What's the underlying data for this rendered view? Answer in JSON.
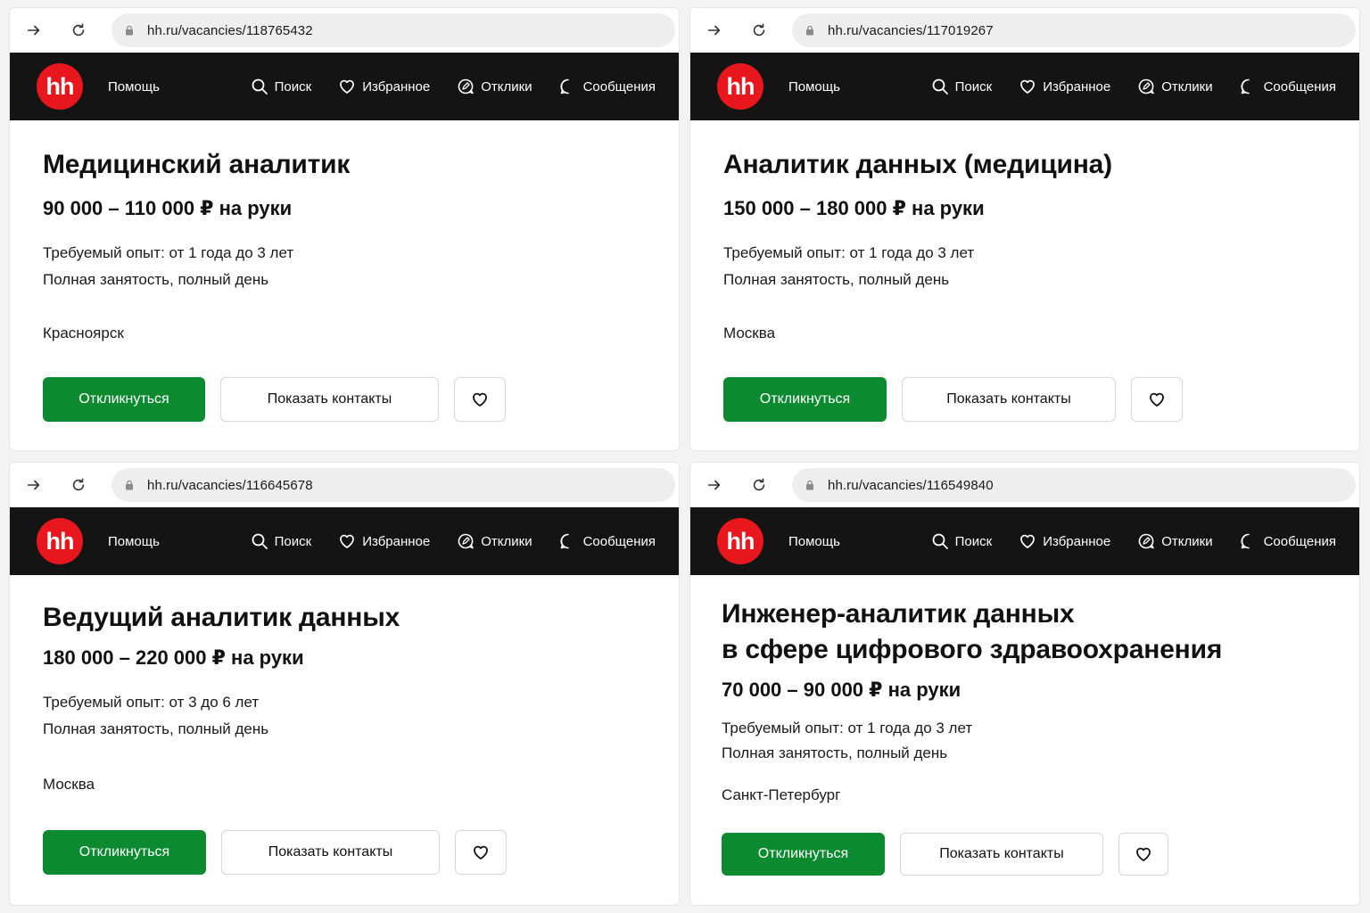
{
  "colors": {
    "brand_red": "#e8171d",
    "header_bg": "#141414",
    "apply_green": "#0b8a2f"
  },
  "icons": {
    "forward": "arrow-right-icon",
    "reload": "reload-icon",
    "lock": "lock-icon",
    "search": "search-icon",
    "favorites": "heart-icon",
    "responses": "chat-pen-icon",
    "messages": "chat-bubble-icon"
  },
  "common": {
    "logo_text": "hh",
    "help": "Помощь",
    "nav": {
      "search": "Поиск",
      "favorites": "Избранное",
      "responses": "Отклики",
      "messages": "Сообщения"
    },
    "apply_label": "Откликнуться",
    "contacts_label": "Показать контакты"
  },
  "vacancies": [
    {
      "url": "hh.ru/vacancies/118765432",
      "title_line1": "Медицинский аналитик",
      "title_line2": "",
      "salary": "90 000 – 110 000 ₽ на руки",
      "experience": "Требуемый опыт: от 1 года до 3 лет",
      "employment": "Полная занятость, полный день",
      "city": "Красноярск"
    },
    {
      "url": "hh.ru/vacancies/117019267",
      "title_line1": "Аналитик данных (медицина)",
      "title_line2": "",
      "salary": "150 000 – 180 000 ₽ на руки",
      "experience": "Требуемый опыт: от 1 года до 3 лет",
      "employment": "Полная занятость, полный день",
      "city": "Москва"
    },
    {
      "url": "hh.ru/vacancies/116645678",
      "title_line1": "Ведущий аналитик данных",
      "title_line2": "",
      "salary": "180 000 – 220 000 ₽ на руки",
      "experience": "Требуемый опыт: от 3 до 6 лет",
      "employment": "Полная занятость, полный день",
      "city": "Москва"
    },
    {
      "url": "hh.ru/vacancies/116549840",
      "title_line1": "Инженер-аналитик данных",
      "title_line2": "в сфере цифрового здравоохранения",
      "salary": "70 000 – 90 000 ₽ на руки",
      "experience": "Требуемый опыт: от 1 года до 3 лет",
      "employment": "Полная занятость, полный день",
      "city": "Санкт-Петербург"
    }
  ]
}
